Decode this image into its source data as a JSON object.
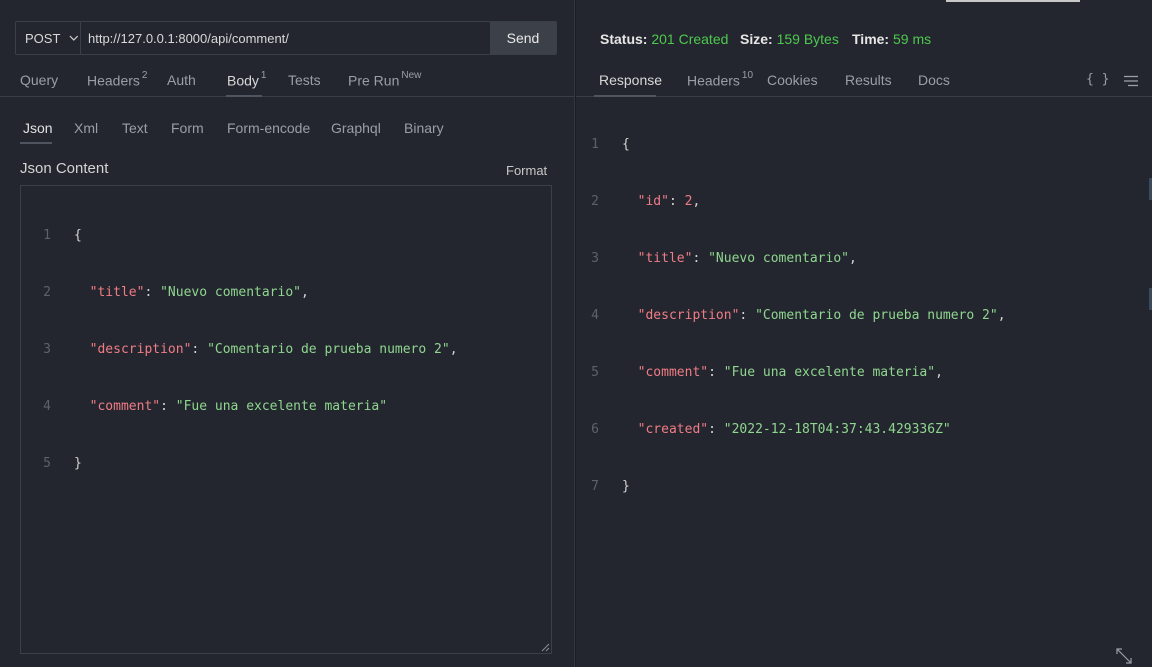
{
  "request": {
    "method": "POST",
    "url": "http://127.0.0.1:8000/api/comment/",
    "send_label": "Send",
    "tabs": [
      {
        "label": "Query",
        "badge": ""
      },
      {
        "label": "Headers",
        "badge": "2"
      },
      {
        "label": "Auth",
        "badge": ""
      },
      {
        "label": "Body",
        "badge": "1"
      },
      {
        "label": "Tests",
        "badge": ""
      },
      {
        "label": "Pre Run",
        "badge": "New"
      }
    ],
    "active_tab": "Body",
    "body_tabs": [
      "Json",
      "Xml",
      "Text",
      "Form",
      "Form-encode",
      "Graphql",
      "Binary"
    ],
    "active_body_tab": "Json",
    "json_label": "Json Content",
    "format_label": "Format",
    "line_numbers": [
      "1",
      "2",
      "3",
      "4",
      "5"
    ]
  },
  "request_body": {
    "l1_open": "{",
    "l2_key": "\"title\"",
    "l2_val": "\"Nuevo comentario\"",
    "l3_key": "\"description\"",
    "l3_val": "\"Comentario de prueba numero 2\"",
    "l4_key": "\"comment\"",
    "l4_val": "\"Fue una excelente materia\"",
    "l5_close": "}"
  },
  "response": {
    "status_label": "Status:",
    "status_value": "201 Created",
    "size_label": "Size:",
    "size_value": "159 Bytes",
    "time_label": "Time:",
    "time_value": "59 ms",
    "tabs": [
      {
        "label": "Response",
        "badge": ""
      },
      {
        "label": "Headers",
        "badge": "10"
      },
      {
        "label": "Cookies",
        "badge": ""
      },
      {
        "label": "Results",
        "badge": ""
      },
      {
        "label": "Docs",
        "badge": ""
      }
    ],
    "active_tab": "Response",
    "braces_icon": "{ }",
    "line_numbers": [
      "1",
      "2",
      "3",
      "4",
      "5",
      "6",
      "7"
    ]
  },
  "response_body": {
    "l1_open": "{",
    "l2_key": "\"id\"",
    "l2_val": "2",
    "l3_key": "\"title\"",
    "l3_val": "\"Nuevo comentario\"",
    "l4_key": "\"description\"",
    "l4_val": "\"Comentario de prueba numero 2\"",
    "l5_key": "\"comment\"",
    "l5_val": "\"Fue una excelente materia\"",
    "l6_key": "\"created\"",
    "l6_val": "\"2022-12-18T04:37:43.429336Z\"",
    "l7_close": "}"
  },
  "colors": {
    "background": "#23262e",
    "status_green": "#4ec94e",
    "json_key": "#f07c86",
    "json_string": "#8fd68f",
    "send_button": "#3c4049"
  },
  "icons": {
    "method_dropdown": "chevron-down-icon",
    "format": "braces-icon",
    "menu": "menu-lines-icon",
    "expand": "expand-diagonal-icon",
    "resize": "resize-grip-icon"
  }
}
